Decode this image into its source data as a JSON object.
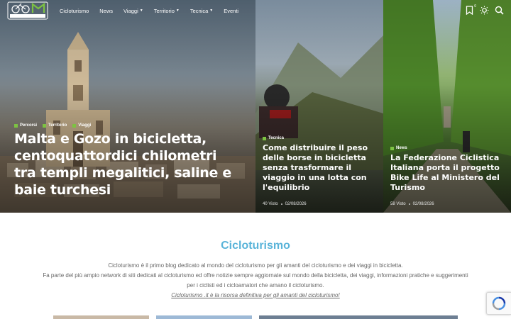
{
  "nav": {
    "items": [
      {
        "label": "Cicloturismo",
        "caret": false
      },
      {
        "label": "News",
        "caret": false
      },
      {
        "label": "Viaggi",
        "caret": true
      },
      {
        "label": "Territorio",
        "caret": true
      },
      {
        "label": "Tecnica",
        "caret": true
      },
      {
        "label": "Eventi",
        "caret": false
      }
    ],
    "bookmark_count": "0"
  },
  "hero": {
    "main": {
      "categories": [
        "Percorsi",
        "Territorio",
        "Viaggi"
      ],
      "title": "Malta e Gozo in bicicletta, centoquattordici chilometri tra templi megalitici, saline e baie turchesi"
    },
    "second": {
      "category": "Tecnica",
      "title": "Come distribuire il peso delle borse in bicicletta senza trasformare il viaggio in una lotta con l'equilibrio",
      "views": "40 Visto",
      "date": "02/08/2026"
    },
    "third": {
      "category": "News",
      "title": "La Federazione Ciclistica Italiana porta il progetto Bike Life al Ministero del Turismo",
      "views": "58 Visto",
      "date": "02/08/2026"
    }
  },
  "intro": {
    "title": "Cicloturismo",
    "line1": "Cicloturismo è il primo blog dedicato al mondo del cicloturismo per gli amanti del cicloturismo e dei viaggi in bicicletta.",
    "line2": "Fa parte del più ampio network di siti dedicati al cicloturismo ed offre notizie sempre aggiornate sul mondo della bicicletta, dei viaggi, informazioni pratiche e suggerimenti per i ciclisti ed i cicloamatori che amano il cicloturismo.",
    "link": "Cicloturismo .it è la risorsa definitiva per gli amanti del cicloturismo!"
  },
  "colors": {
    "accent_green": "#7cc242",
    "title_blue": "#5ab4d9"
  }
}
